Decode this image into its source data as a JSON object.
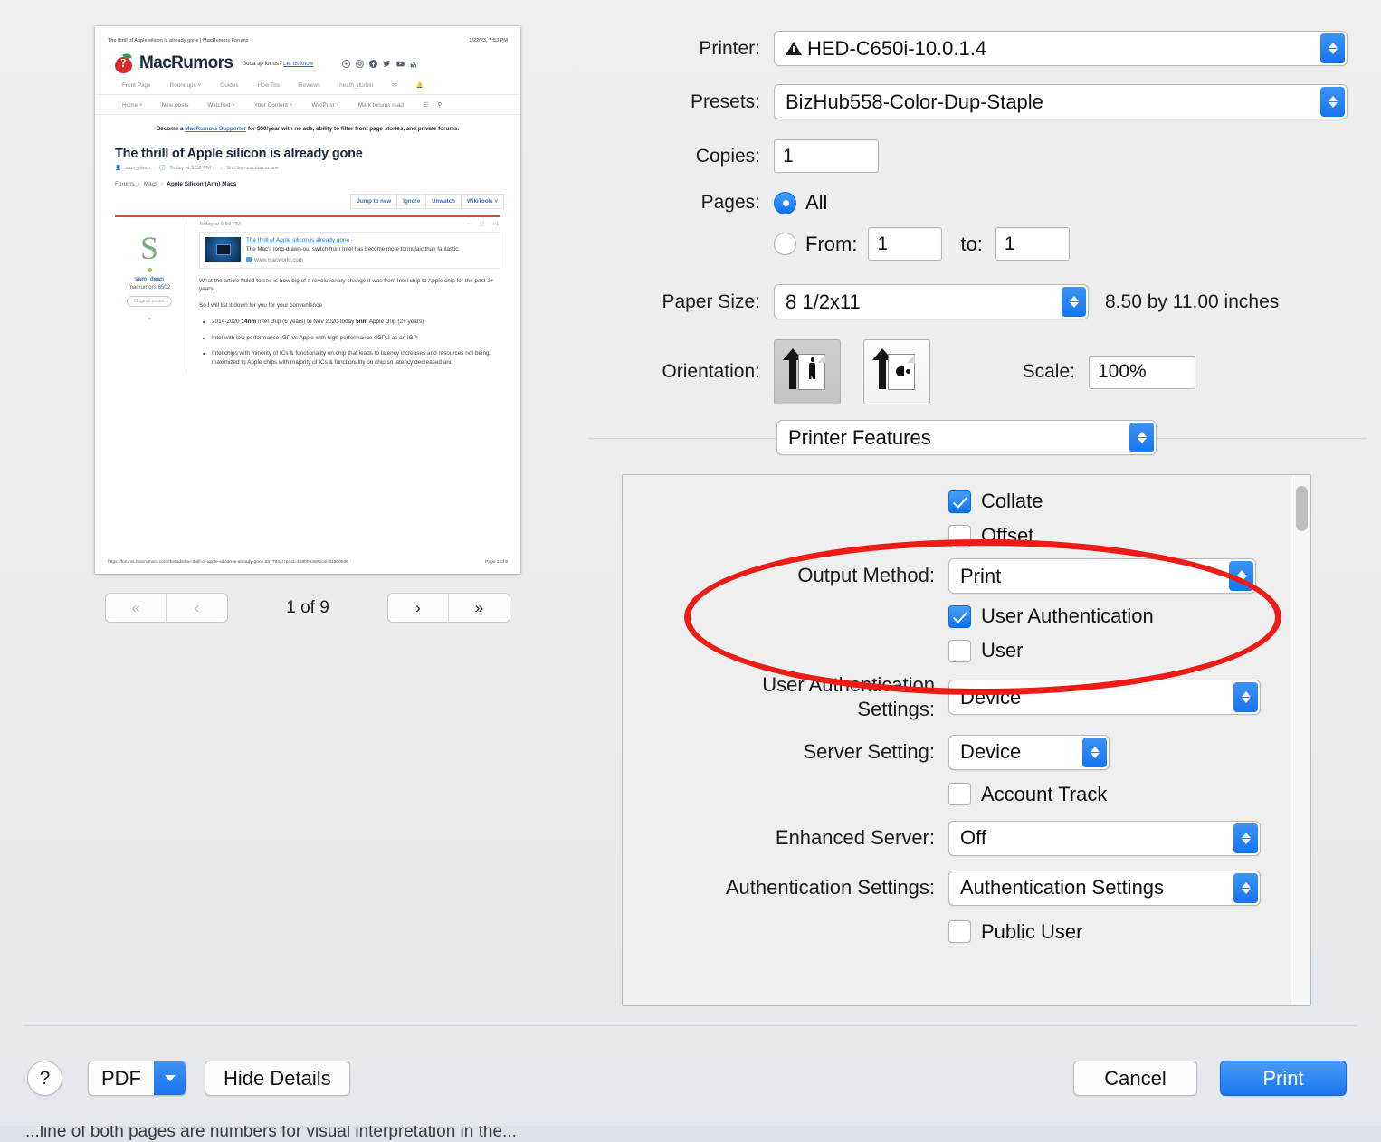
{
  "dialog": {
    "printer_label": "Printer:",
    "printer_value": "HED-C650i-10.0.1.4",
    "presets_label": "Presets:",
    "presets_value": "BizHub558-Color-Dup-Staple",
    "copies_label": "Copies:",
    "copies_value": "1",
    "pages_label": "Pages:",
    "pages_all_label": "All",
    "pages_from_label": "From:",
    "pages_from_value": "1",
    "pages_to_label": "to:",
    "pages_to_value": "1",
    "paper_size_label": "Paper Size:",
    "paper_size_value": "8 1/2x11",
    "paper_size_note": "8.50 by 11.00 inches",
    "orientation_label": "Orientation:",
    "scale_label": "Scale:",
    "scale_value": "100%",
    "pane_popup_value": "Printer Features"
  },
  "features": {
    "collate_label": "Collate",
    "collate_checked": true,
    "offset_label": "Offset",
    "offset_checked": false,
    "output_method_label": "Output Method:",
    "output_method_value": "Print",
    "user_authentication_label": "User Authentication",
    "user_authentication_checked": true,
    "user_label": "User",
    "user_checked": false,
    "user_auth_settings_label_line1": "User Authentication",
    "user_auth_settings_label_line2": "Settings:",
    "user_auth_settings_value": "Device",
    "server_setting_label": "Server Setting:",
    "server_setting_value": "Device",
    "account_track_label": "Account Track",
    "account_track_checked": false,
    "enhanced_server_label": "Enhanced Server:",
    "enhanced_server_value": "Off",
    "authentication_settings_label": "Authentication Settings:",
    "authentication_settings_value": "Authentication Settings",
    "public_user_label": "Public User",
    "public_user_checked": false
  },
  "buttons": {
    "help": "?",
    "pdf": "PDF",
    "hide_details": "Hide Details",
    "cancel": "Cancel",
    "print": "Print"
  },
  "pager": {
    "first": "«",
    "prev": "‹",
    "label": "1 of 9",
    "next": "›",
    "last": "»"
  },
  "preview": {
    "header_title": "The thrill of Apple silicon is already gone | MacRumors Forums",
    "header_date": "1/22/23, 7:53 PM",
    "brand": "MacRumors",
    "tip_text": "Got a tip for us?",
    "tip_link": "Let us know",
    "nav_primary": [
      "Front Page",
      "Roundups ˅",
      "Guides",
      "How Tos",
      "Reviews"
    ],
    "nav_account": "heath_durbin",
    "nav_secondary": [
      "Home ˅",
      "New posts",
      "Watched ˅",
      "Your Content ˅",
      "WikiPost ˅",
      "Mark forums read"
    ],
    "banner_pre": "Become a ",
    "banner_link": "MacRumors Supporter",
    "banner_post": " for $50/year with no ads, ability to filter front page stories, and private forums.",
    "article_title": "The thrill of Apple silicon is already gone",
    "byline_user": "sam_dean",
    "byline_time": "Today at 5:56 PM",
    "byline_sort": "Sort by reaction score",
    "crumb_1": "Forums",
    "crumb_2": "Macs",
    "crumb_3": "Apple Silicon (Arm) Macs",
    "thread_buttons": [
      "Jump to new",
      "Ignore",
      "Unwatch",
      "WikiTools ˅"
    ],
    "post_time": "Today at 5:56 PM",
    "post_number": "#1",
    "avatar_letter": "S",
    "author_name": "sam_dean",
    "author_rank": "macrumors 6502",
    "author_badge": "Original poster",
    "card_title": "The thrill of Apple silicon is already gone",
    "card_desc": "The Mac's long-drawn-out switch from Intel has become more formulaic than fantastic.",
    "card_source": "www.macworld.com",
    "body_p1": "What the article failed to see is how big of a revolutionary change it was from Intel chip to Apple chip for the past 2+ years.",
    "body_p2": "So I will list it down for you for your convenience",
    "bullet_1_a": "2014-2020 ",
    "bullet_1_b": "14nm",
    "bullet_1_c": " Intel chip (6 years) to Nov 2020-today ",
    "bullet_1_d": "5nm",
    "bullet_1_e": " Apple chip (2+ years)",
    "bullet_2": "Intel with low performance IGP vs Apple with high performance dGPU as an IGP",
    "bullet_3": "Intel chips with minority of ICs & functionality on chip that leads to latency increases and resources not being maximized to Apple chips with majority of ICs & functionality on chip so latency decreased and",
    "footer_url": "https://forums.macrumors.com/threads/the-thrill-of-apple-silicon-is-already-gone.2377944/?post=31900936#post-31900936",
    "footer_page": "Page 1 of 9"
  },
  "background_text": "...line of both pages are numbers for visual interpretation in the..."
}
